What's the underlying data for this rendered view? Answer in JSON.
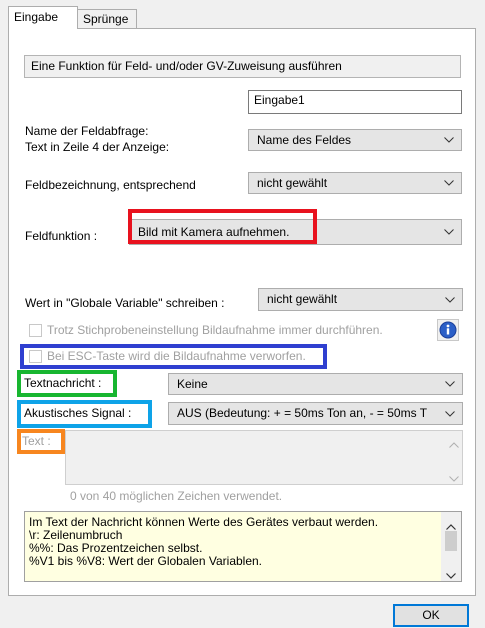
{
  "tabs": [
    {
      "label": "Eingabe",
      "active": true
    },
    {
      "label": "Sprünge",
      "active": false
    }
  ],
  "description": "Eine Funktion für Feld- und/oder GV-Zuweisung ausführen",
  "fields": {
    "name_label": "Name der Feldabfrage:",
    "name_value": "Eingabe1",
    "line4_label": "Text in Zeile 4 der Anzeige:",
    "line4_value": "Name des Feldes",
    "fieldname_label": "Feldbezeichnung, entsprechend",
    "fieldname_value": "nicht gewählt",
    "function_label": "Feldfunktion :",
    "function_value": "Bild mit Kamera aufnehmen.",
    "globalvar_label": "Wert in \"Globale Variable\" schreiben :",
    "globalvar_value": "nicht gewählt"
  },
  "checkboxes": {
    "always_capture": "Trotz Stichprobeneinstellung Bildaufnahme immer durchführen.",
    "esc_discard": "Bei ESC-Taste wird die Bildaufnahme verworfen."
  },
  "message": {
    "label": "Textnachricht :",
    "value": "Keine"
  },
  "sound": {
    "label": "Akustisches Signal :",
    "value": "AUS (Bedeutung: + = 50ms Ton an, - = 50ms T"
  },
  "text": {
    "label": "Text :",
    "counter": "0 von 40 möglichen Zeichen verwendet."
  },
  "note_lines": [
    "Im Text der Nachricht können Werte des Gerätes verbaut werden.",
    "\\r: Zeilenumbruch",
    "%%: Das Prozentzeichen selbst.",
    "%V1 bis %V8: Wert der Globalen Variablen."
  ],
  "buttons": {
    "ok": "OK"
  },
  "colors": {
    "highlight_red": "#e8121e",
    "highlight_blue": "#2f3fd0",
    "highlight_green": "#18b630",
    "highlight_cyan": "#0ea3e8",
    "highlight_orange": "#f7861f",
    "info_icon": "#2b5fc7"
  },
  "icons": {
    "info": "info-circle-icon",
    "dropdown": "chevron-down-icon",
    "scroll_up": "chevron-up-icon",
    "scroll_down": "chevron-down-icon"
  }
}
